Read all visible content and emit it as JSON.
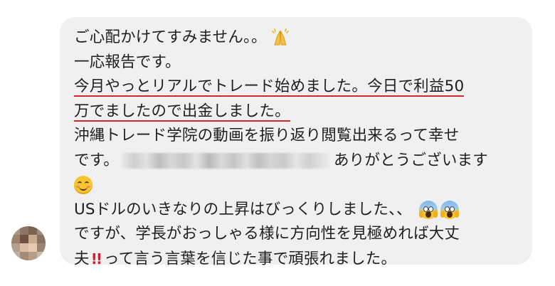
{
  "message": {
    "line1": "ご心配かけてすみません。。",
    "line2": "一応報告です。",
    "line3": "今月やっとリアルでトレード始めました。今日で利益50",
    "line4": "万でましたので出金しました。",
    "line5": "沖縄トレード学院の動画を振り返り閲覧出来るって幸せ",
    "line6_a": "です。",
    "line6_b": "ありがとうございます",
    "line8": "USドルのいきなりの上昇はびっくりしました、、",
    "line9": "ですが、学長がおっしゃる様に方向性を見極めれば大丈",
    "line10_a": "夫",
    "line10_b": "って言う言葉を信じた事で頑張れました。"
  },
  "icons": {
    "emoji_1": "folded-hands-icon",
    "emoji_2": "smiling-face-icon",
    "emoji_3": "face-screaming-in-fear-icon",
    "emoji_4": "double-exclamation-icon"
  },
  "colors": {
    "bubble": "#f0f0f0",
    "text": "#1c1e21",
    "underline": "#d7262b",
    "exclamation": "#d0202b"
  }
}
